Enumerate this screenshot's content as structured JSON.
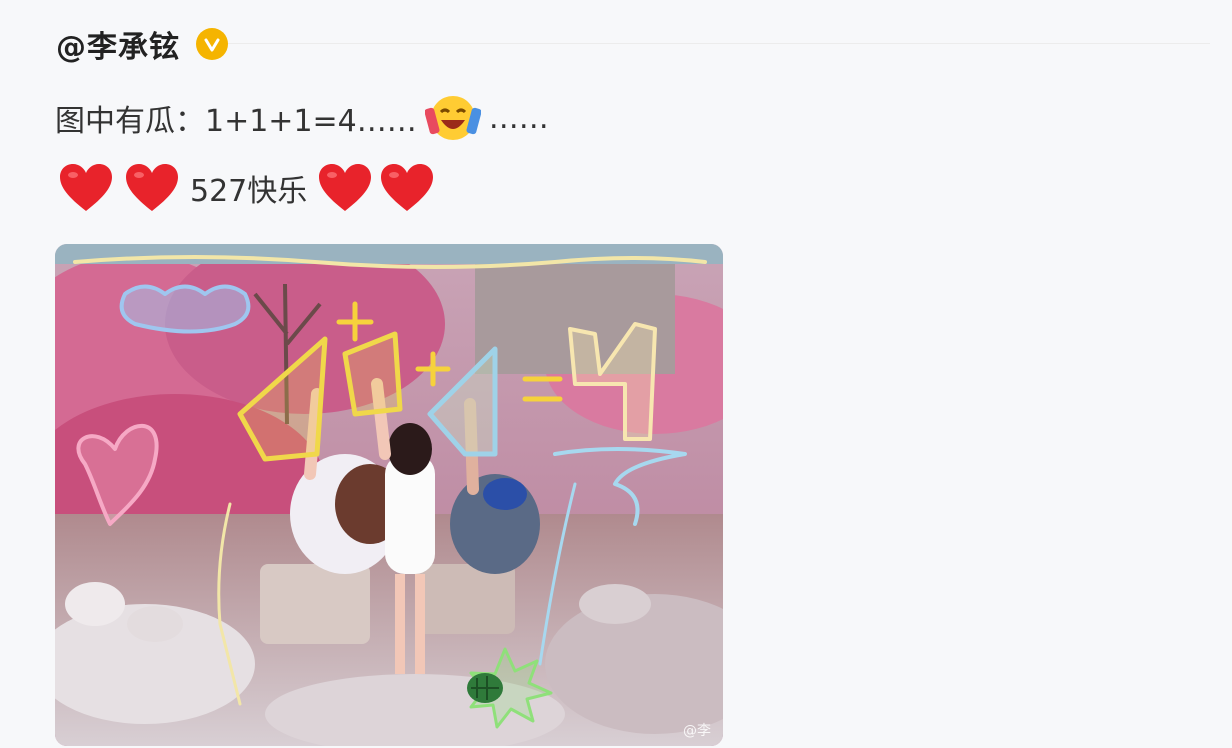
{
  "post": {
    "author": "@李承铉",
    "verified_icon": "verified-badge-icon",
    "text_line1": "图中有瓜：1+1+1=4……",
    "text_line1_tail": "……",
    "text_line2_middle": "527快乐",
    "emoji_line1": "laughing-celebration-emoji",
    "emoji_heart": "red-heart-emoji",
    "image_caption_doodle": "1+1+1=4",
    "image_watermark": "@李"
  },
  "colors": {
    "background": "#f7f8fa",
    "verified": "#f5b400",
    "heart": "#e8232b"
  }
}
